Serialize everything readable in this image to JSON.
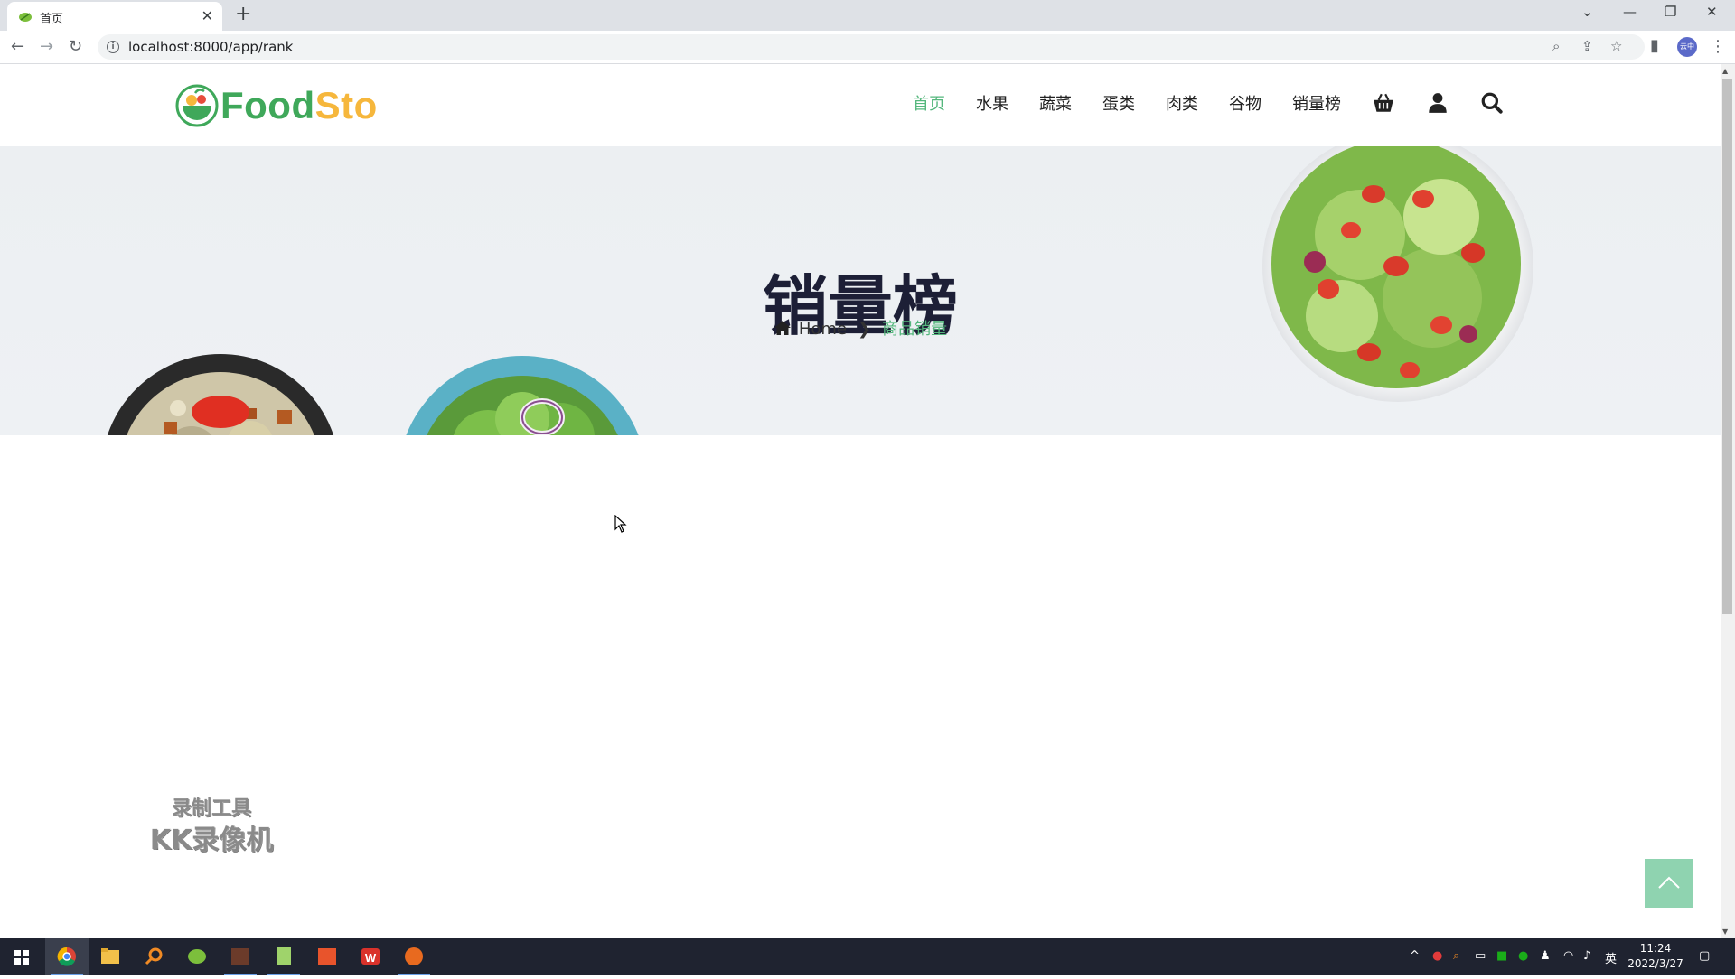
{
  "browser": {
    "tab": {
      "title": "首页"
    },
    "url": "localhost:8000/app/rank",
    "profile_label": "云中"
  },
  "site": {
    "logo": {
      "part1": "Food",
      "part2": "Sto"
    },
    "nav": [
      {
        "label": "首页",
        "active": true
      },
      {
        "label": "水果"
      },
      {
        "label": "蔬菜"
      },
      {
        "label": "蛋类"
      },
      {
        "label": "肉类"
      },
      {
        "label": "谷物"
      },
      {
        "label": "销量榜"
      }
    ],
    "nav_icons": [
      "basket-icon",
      "user-icon",
      "search-icon"
    ]
  },
  "hero": {
    "title": "销量榜",
    "breadcrumb": {
      "home": "Home",
      "current": "商品销量"
    }
  },
  "watermark": {
    "line1": "录制工具",
    "line2": "KK录像机"
  },
  "taskbar": {
    "time": "11:24",
    "date": "2022/3/27",
    "ime": "英"
  },
  "colors": {
    "accent": "#55b77d",
    "logo_green": "#3fa85a",
    "logo_yellow": "#f6b73c",
    "title_dark": "#1d1f36"
  }
}
